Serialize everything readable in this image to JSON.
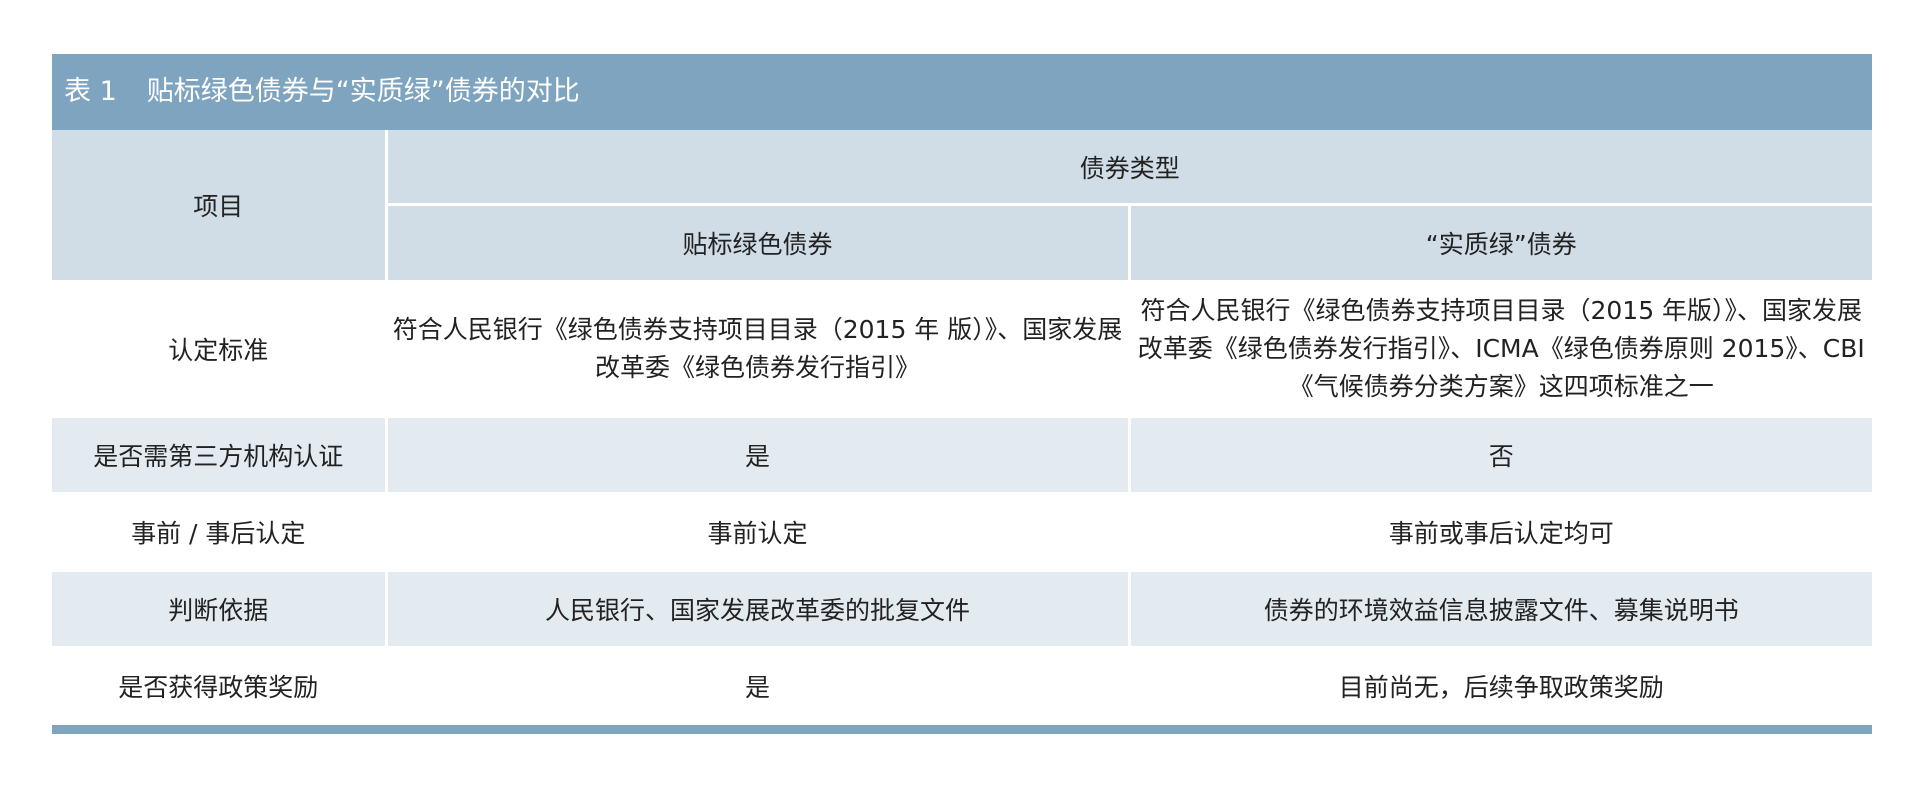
{
  "table": {
    "number": "表 1",
    "title": "贴标绿色债券与“实质绿”债券的对比",
    "header": {
      "item": "项目",
      "group": "债券类型",
      "col_labeled": "贴标绿色债券",
      "col_substantive": "“实质绿”债券"
    },
    "rows": [
      {
        "item": "认定标准",
        "labeled": "符合人民银行《绿色债券支持项目目录（2015 年 版）》、国家发展改革委《绿色债券发行指引》",
        "substantive": "符合人民银行《绿色债券支持项目目录（2015 年版）》、国家发展改革委《绿色债券发行指引》、ICMA《绿色债券原则 2015》、CBI《气候债券分类方案》这四项标准之一"
      },
      {
        "item": "是否需第三方机构认证",
        "labeled": "是",
        "substantive": "否"
      },
      {
        "item": "事前 / 事后认定",
        "labeled": "事前认定",
        "substantive": "事前或事后认定均可"
      },
      {
        "item": "判断依据",
        "labeled": "人民银行、国家发展改革委的批复文件",
        "substantive": "债券的环境效益信息披露文件、募集说明书"
      },
      {
        "item": "是否获得政策奖励",
        "labeled": "是",
        "substantive": "目前尚无，后续争取政策奖励"
      }
    ]
  },
  "colors": {
    "title_bar": "#7fa4c0",
    "header_bg": "#d0dde7",
    "stripe_bg": "#e3ebf1",
    "title_text": "#ffffff"
  }
}
